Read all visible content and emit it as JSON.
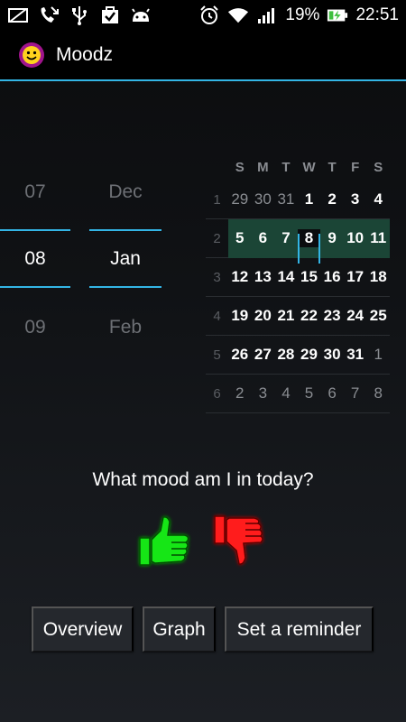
{
  "status_bar": {
    "battery_percent": "19%",
    "time": "22:51"
  },
  "action_bar": {
    "title": "Moodz"
  },
  "picker": {
    "day": {
      "prev": "07",
      "current": "08",
      "next": "09"
    },
    "month": {
      "prev": "Dec",
      "current": "Jan",
      "next": "Feb"
    }
  },
  "calendar": {
    "weekday_headers": [
      "S",
      "M",
      "T",
      "W",
      "T",
      "F",
      "S"
    ],
    "weeks": [
      {
        "week": "1",
        "days": [
          "29",
          "30",
          "31",
          "1",
          "2",
          "3",
          "4"
        ],
        "other_month": [
          true,
          true,
          true,
          false,
          false,
          false,
          false
        ]
      },
      {
        "week": "2",
        "days": [
          "5",
          "6",
          "7",
          "8",
          "9",
          "10",
          "11"
        ],
        "other_month": [
          false,
          false,
          false,
          false,
          false,
          false,
          false
        ],
        "selected": true,
        "today_index": 3
      },
      {
        "week": "3",
        "days": [
          "12",
          "13",
          "14",
          "15",
          "16",
          "17",
          "18"
        ],
        "other_month": [
          false,
          false,
          false,
          false,
          false,
          false,
          false
        ]
      },
      {
        "week": "4",
        "days": [
          "19",
          "20",
          "21",
          "22",
          "23",
          "24",
          "25"
        ],
        "other_month": [
          false,
          false,
          false,
          false,
          false,
          false,
          false
        ]
      },
      {
        "week": "5",
        "days": [
          "26",
          "27",
          "28",
          "29",
          "30",
          "31",
          "1"
        ],
        "other_month": [
          false,
          false,
          false,
          false,
          false,
          false,
          true
        ]
      },
      {
        "week": "6",
        "days": [
          "2",
          "3",
          "4",
          "5",
          "6",
          "7",
          "8"
        ],
        "other_month": [
          true,
          true,
          true,
          true,
          true,
          true,
          true
        ]
      }
    ]
  },
  "question": "What mood am I in today?",
  "buttons": {
    "overview": "Overview",
    "graph": "Graph",
    "reminder": "Set a reminder"
  },
  "colors": {
    "accent": "#33b5e5",
    "thumb_up": "#19e619",
    "thumb_down": "#ff1a1a",
    "selected_week": "#1b4536"
  }
}
